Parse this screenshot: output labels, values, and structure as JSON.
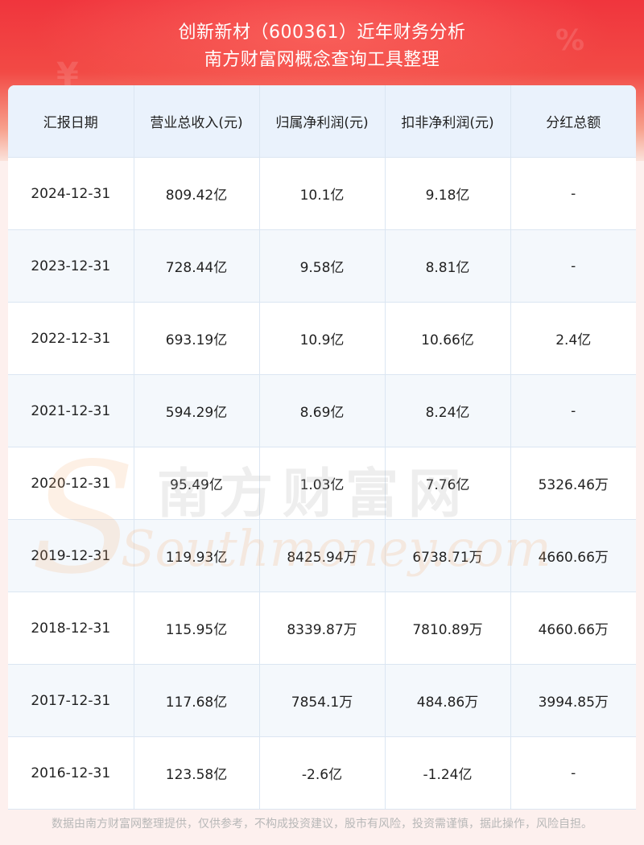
{
  "header": {
    "title_line1": "创新新材（600361）近年财务分析",
    "title_line2": "南方财富网概念查询工具整理"
  },
  "table": {
    "columns": [
      "汇报日期",
      "营业总收入(元)",
      "归属净利润(元)",
      "扣非净利润(元)",
      "分红总额"
    ],
    "rows": [
      [
        "2024-12-31",
        "809.42亿",
        "10.1亿",
        "9.18亿",
        "-"
      ],
      [
        "2023-12-31",
        "728.44亿",
        "9.58亿",
        "8.81亿",
        "-"
      ],
      [
        "2022-12-31",
        "693.19亿",
        "10.9亿",
        "10.66亿",
        "2.4亿"
      ],
      [
        "2021-12-31",
        "594.29亿",
        "8.69亿",
        "8.24亿",
        "-"
      ],
      [
        "2020-12-31",
        "95.49亿",
        "1.03亿",
        "7.76亿",
        "5326.46万"
      ],
      [
        "2019-12-31",
        "119.93亿",
        "8425.94万",
        "6738.71万",
        "4660.66万"
      ],
      [
        "2018-12-31",
        "115.95亿",
        "8339.87万",
        "7810.89万",
        "4660.66万"
      ],
      [
        "2017-12-31",
        "117.68亿",
        "7854.1万",
        "484.86万",
        "3994.85万"
      ],
      [
        "2016-12-31",
        "123.58亿",
        "-2.6亿",
        "-1.24亿",
        "-"
      ]
    ]
  },
  "watermark": {
    "cn": "南方财富网",
    "en": "Southmoney.com",
    "s_glyph": "S"
  },
  "footer": {
    "disclaimer": "数据由南方财富网整理提供，仅供参考，不构成投资建议，股市有风险，投资需谨慎，据此操作，风险自担。"
  },
  "colors": {
    "banner_red": "#f0353d",
    "header_row_bg": "#eaf2fc",
    "zebra_bg": "#f4f8fc",
    "border": "#dbe6f2"
  }
}
